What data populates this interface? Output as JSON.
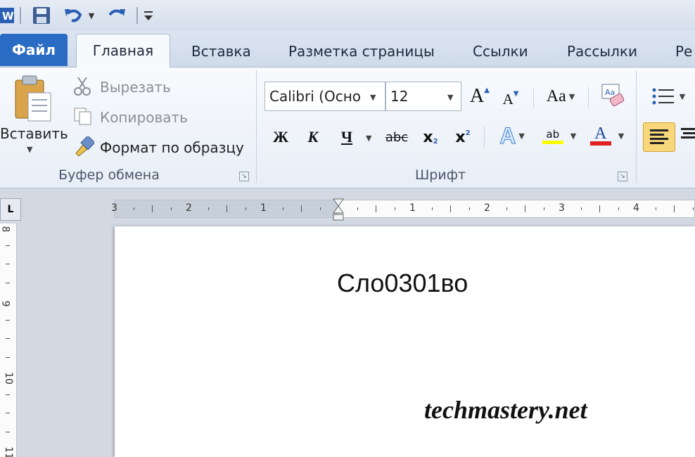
{
  "quick_access": {
    "icons": [
      "word-logo-icon",
      "save-icon",
      "undo-icon",
      "redo-icon",
      "customize-qat-icon"
    ]
  },
  "tabs": {
    "file": "Файл",
    "home": "Главная",
    "insert": "Вставка",
    "page_layout": "Разметка страницы",
    "references": "Ссылки",
    "mailings": "Рассылки",
    "review_partial": "Ре"
  },
  "clipboard": {
    "paste": "Вставить",
    "cut": "Вырезать",
    "copy": "Копировать",
    "format_painter": "Формат по образцу",
    "group_label": "Буфер обмена"
  },
  "font": {
    "font_name": "Calibri (Осно",
    "font_size": "12",
    "bold": "Ж",
    "italic": "К",
    "underline": "Ч",
    "strike": "abc",
    "subscript": "x",
    "subscript_small": "2",
    "superscript": "x",
    "superscript_small": "2",
    "grow": "A",
    "shrink": "A",
    "change_case": "Aa",
    "effects": "A",
    "highlight": "ab",
    "font_color": "A",
    "group_label": "Шрифт",
    "font_color_value": "#e02020",
    "highlight_color_value": "#ffff00"
  },
  "ruler": {
    "left_numbers": [
      "3",
      "2",
      "1"
    ],
    "right_numbers": [
      "1",
      "2",
      "3",
      "4"
    ],
    "vertical_numbers": [
      "8",
      "9",
      "10",
      "11"
    ],
    "tab_stop_symbol": "L"
  },
  "document": {
    "text": "Сло0301во",
    "watermark": "techmastery.net"
  },
  "colors": {
    "file_tab": "#2a6cc4",
    "align_selected": "#f8d77a"
  }
}
